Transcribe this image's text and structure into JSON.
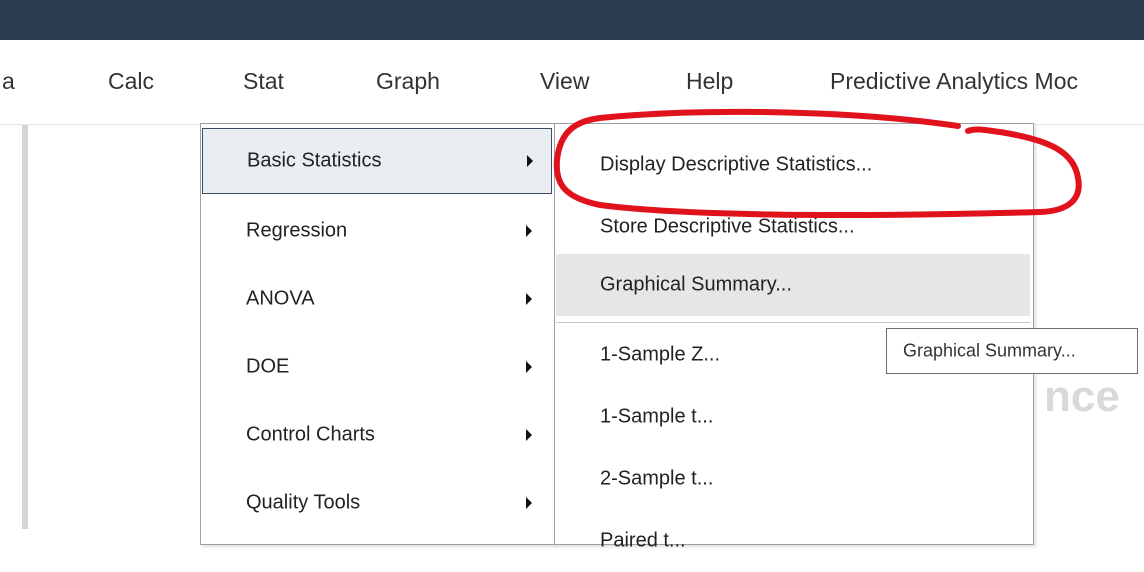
{
  "menubar": {
    "items": [
      {
        "label": "a"
      },
      {
        "label": "Calc"
      },
      {
        "label": "Stat"
      },
      {
        "label": "Graph"
      },
      {
        "label": "View"
      },
      {
        "label": "Help"
      },
      {
        "label": "Predictive Analytics Moc"
      }
    ]
  },
  "stat_menu": {
    "items": [
      {
        "label": "Basic Statistics",
        "active": true
      },
      {
        "label": "Regression"
      },
      {
        "label": "ANOVA"
      },
      {
        "label": "DOE"
      },
      {
        "label": "Control Charts"
      },
      {
        "label": "Quality Tools"
      }
    ]
  },
  "basic_statistics_menu": {
    "items": [
      {
        "label": "Display Descriptive Statistics..."
      },
      {
        "label": "Store Descriptive Statistics..."
      },
      {
        "label": "Graphical Summary...",
        "hovered": true
      },
      {
        "label": "1-Sample Z..."
      },
      {
        "label": "1-Sample t..."
      },
      {
        "label": "2-Sample t..."
      },
      {
        "label": "Paired t..."
      }
    ]
  },
  "tooltip": {
    "text": "Graphical Summary..."
  },
  "background_text": "nce",
  "annotation": {
    "color": "#e0121b"
  }
}
